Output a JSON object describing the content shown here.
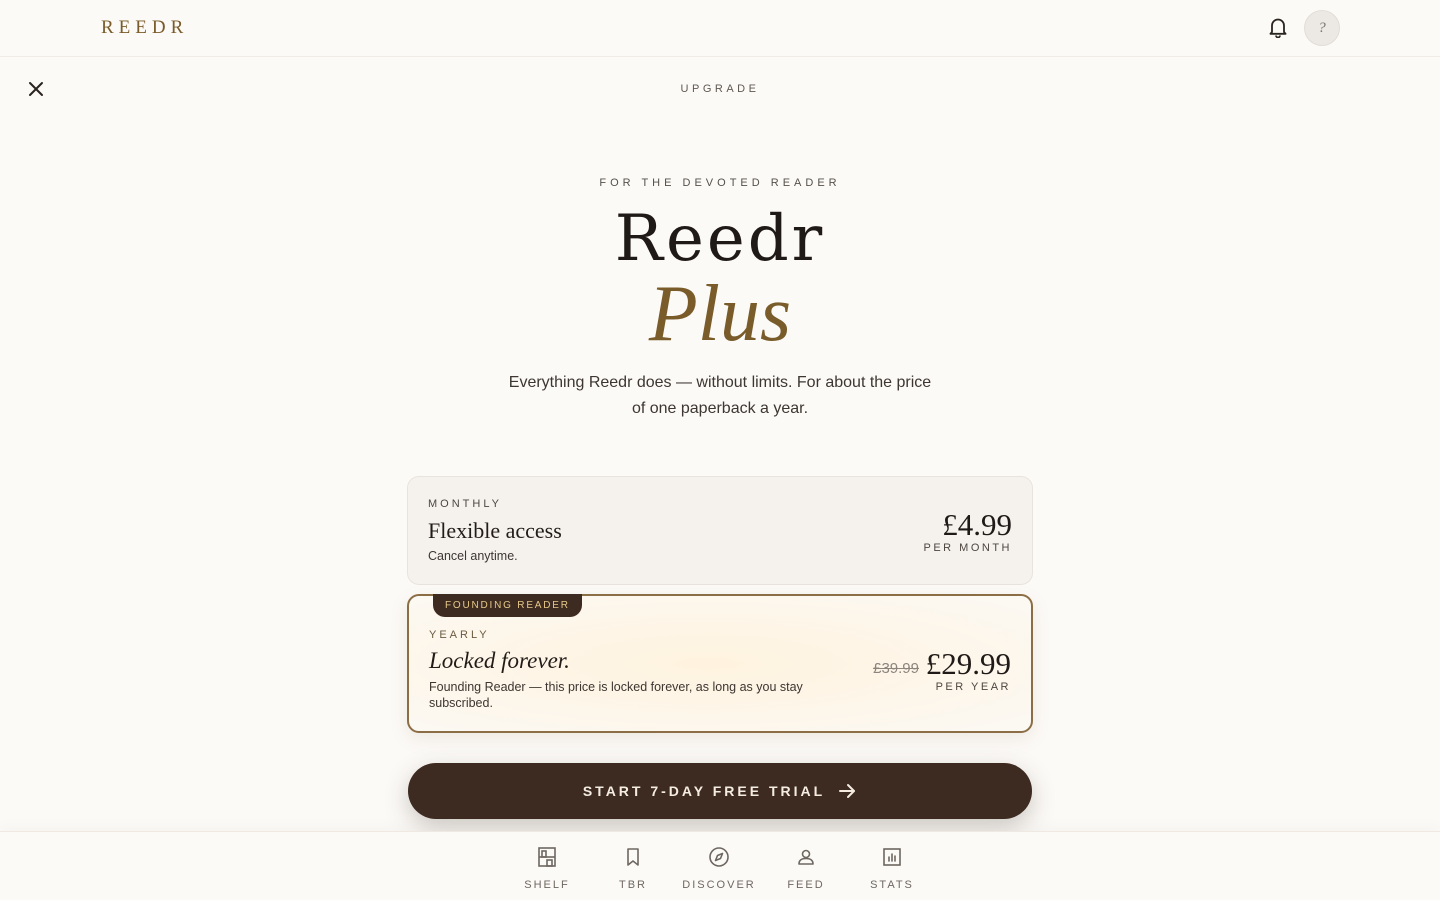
{
  "header": {
    "logo": "REEDR",
    "notifications_icon": "bell-icon",
    "avatar_text": "?"
  },
  "modal": {
    "close_icon": "close-icon",
    "label": "UPGRADE",
    "eyebrow": "FOR THE DEVOTED READER",
    "title_main": "Reedr",
    "title_accent": "Plus",
    "subtitle": "Everything Reedr does — without limits. For about the price of one paperback a year."
  },
  "plans": {
    "monthly": {
      "kicker": "MONTHLY",
      "name": "Flexible access",
      "description": "Cancel anytime.",
      "price": "£4.99",
      "period": "PER MONTH"
    },
    "yearly": {
      "badge": "FOUNDING READER",
      "kicker": "YEARLY",
      "name": "Locked forever.",
      "description": "Founding Reader — this price is locked forever, as long as you stay subscribed.",
      "old_price": "£39.99",
      "price": "£29.99",
      "period": "PER YEAR",
      "selected": true
    }
  },
  "cta": {
    "label": "START 7-DAY FREE TRIAL",
    "icon": "arrow-right-icon"
  },
  "bottom_nav": {
    "items": [
      {
        "label": "SHELF",
        "icon": "bookshelf-icon"
      },
      {
        "label": "TBR",
        "icon": "bookmark-icon"
      },
      {
        "label": "DISCOVER",
        "icon": "compass-icon"
      },
      {
        "label": "FEED",
        "icon": "person-icon"
      },
      {
        "label": "STATS",
        "icon": "chart-icon"
      }
    ]
  },
  "colors": {
    "background": "#fcfaf7",
    "accent_gold": "#7a5c2a",
    "primary_dark": "#3d2b21",
    "badge_text": "#e6c889"
  }
}
